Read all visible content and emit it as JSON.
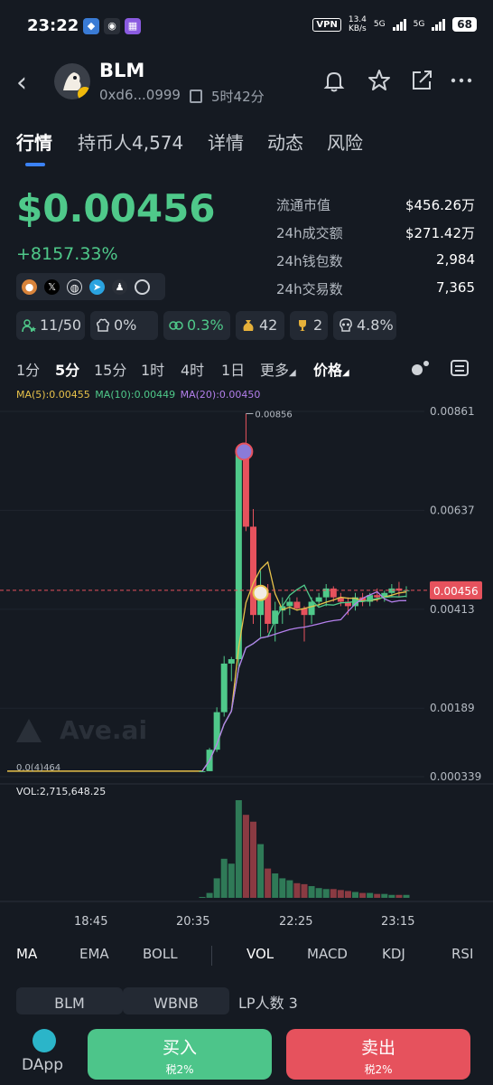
{
  "status": {
    "time": "23:22",
    "vpn": "VPN",
    "net_speed": "13.4",
    "net_unit": "KB/s",
    "sig1": "5G",
    "sig2": "5G",
    "battery": "68"
  },
  "header": {
    "name": "BLM",
    "address": "0xd6...0999",
    "age": "5时42分"
  },
  "tabs": [
    {
      "label": "行情"
    },
    {
      "label": "持币人4,574"
    },
    {
      "label": "详情"
    },
    {
      "label": "动态"
    },
    {
      "label": "风险"
    }
  ],
  "price": {
    "value": "$0.00456",
    "change": "+8157.33%"
  },
  "metrics": [
    {
      "label": "流通市值",
      "value": "$456.26万"
    },
    {
      "label": "24h成交额",
      "value": "$271.42万"
    },
    {
      "label": "24h钱包数",
      "value": "2,984"
    },
    {
      "label": "24h交易数",
      "value": "7,365"
    }
  ],
  "badges": [
    {
      "value": "11/50",
      "icon": "users-star-icon"
    },
    {
      "value": "0%",
      "icon": "chef-hat-icon"
    },
    {
      "value": "0.3%",
      "icon": "link-icon"
    },
    {
      "value": "42",
      "icon": "money-bag-icon"
    },
    {
      "value": "2",
      "icon": "trophy-icon"
    },
    {
      "value": "4.8%",
      "icon": "skull-icon"
    }
  ],
  "intervals": [
    {
      "label": "1分"
    },
    {
      "label": "5分"
    },
    {
      "label": "15分"
    },
    {
      "label": "1时"
    },
    {
      "label": "4时"
    },
    {
      "label": "1日"
    },
    {
      "label": "更多"
    },
    {
      "label": "价格"
    }
  ],
  "ma_legend": {
    "ma5": "MA(5):0.00455",
    "ma10": "MA(10):0.00449",
    "ma20": "MA(20):0.00450"
  },
  "colors": {
    "up": "#4fc98a",
    "down": "#e6525d",
    "ma5": "#e8c24a",
    "ma10": "#4fc98a",
    "ma20": "#b37feb",
    "accent": "#3b82f6"
  },
  "chart_data": {
    "type": "candlestick",
    "y_ticks": [
      "0.00861",
      "0.00637",
      "0.00413",
      "0.00189",
      "0.000339"
    ],
    "current_price": "0.00456",
    "high_label": "0.00856",
    "low_label": "0.0(4)464",
    "volume_label": "VOL:2,715,648.25",
    "watermark": "Ave.ai",
    "x_ticks": [
      "18:45",
      "20:35",
      "22:25",
      "23:15"
    ],
    "candles": [
      {
        "o": 0.000464,
        "h": 0.000464,
        "l": 0.000464,
        "c": 0.000464
      },
      {
        "o": 0.000464,
        "h": 0.00099,
        "l": 0.000464,
        "c": 0.00095
      },
      {
        "o": 0.00095,
        "h": 0.00191,
        "l": 0.0009,
        "c": 0.0018
      },
      {
        "o": 0.0018,
        "h": 0.00307,
        "l": 0.0017,
        "c": 0.0029
      },
      {
        "o": 0.0029,
        "h": 0.00305,
        "l": 0.0025,
        "c": 0.003
      },
      {
        "o": 0.003,
        "h": 0.00782,
        "l": 0.0028,
        "c": 0.0077
      },
      {
        "o": 0.0077,
        "h": 0.00856,
        "l": 0.0059,
        "c": 0.006
      },
      {
        "o": 0.006,
        "h": 0.0064,
        "l": 0.0038,
        "c": 0.004
      },
      {
        "o": 0.004,
        "h": 0.005,
        "l": 0.0035,
        "c": 0.0045
      },
      {
        "o": 0.0045,
        "h": 0.0047,
        "l": 0.0036,
        "c": 0.0038
      },
      {
        "o": 0.0038,
        "h": 0.0043,
        "l": 0.0034,
        "c": 0.0041
      },
      {
        "o": 0.0041,
        "h": 0.0044,
        "l": 0.0038,
        "c": 0.0042
      },
      {
        "o": 0.0042,
        "h": 0.0044,
        "l": 0.004,
        "c": 0.0043
      },
      {
        "o": 0.0043,
        "h": 0.0044,
        "l": 0.0041,
        "c": 0.00415
      },
      {
        "o": 0.00415,
        "h": 0.0042,
        "l": 0.0034,
        "c": 0.004
      },
      {
        "o": 0.004,
        "h": 0.0044,
        "l": 0.0038,
        "c": 0.0043
      },
      {
        "o": 0.0043,
        "h": 0.0045,
        "l": 0.0042,
        "c": 0.0044
      },
      {
        "o": 0.0044,
        "h": 0.0047,
        "l": 0.0042,
        "c": 0.0046
      },
      {
        "o": 0.0046,
        "h": 0.00465,
        "l": 0.0043,
        "c": 0.0044
      },
      {
        "o": 0.0044,
        "h": 0.0045,
        "l": 0.0042,
        "c": 0.0043
      },
      {
        "o": 0.0043,
        "h": 0.0044,
        "l": 0.004,
        "c": 0.0042
      },
      {
        "o": 0.0042,
        "h": 0.0045,
        "l": 0.0041,
        "c": 0.0044
      },
      {
        "o": 0.0044,
        "h": 0.0045,
        "l": 0.0042,
        "c": 0.0043
      },
      {
        "o": 0.0043,
        "h": 0.0045,
        "l": 0.0042,
        "c": 0.00445
      },
      {
        "o": 0.00445,
        "h": 0.0046,
        "l": 0.0043,
        "c": 0.0044
      },
      {
        "o": 0.0044,
        "h": 0.00455,
        "l": 0.0043,
        "c": 0.0045
      },
      {
        "o": 0.0045,
        "h": 0.0047,
        "l": 0.0044,
        "c": 0.0046
      },
      {
        "o": 0.0046,
        "h": 0.00475,
        "l": 0.0044,
        "c": 0.00455
      },
      {
        "o": 0.00455,
        "h": 0.00465,
        "l": 0.0044,
        "c": 0.00456
      }
    ],
    "volumes": [
      0,
      0.05,
      0.2,
      0.4,
      0.35,
      1.0,
      0.85,
      0.78,
      0.55,
      0.3,
      0.25,
      0.2,
      0.18,
      0.15,
      0.14,
      0.12,
      0.1,
      0.09,
      0.09,
      0.08,
      0.07,
      0.06,
      0.05,
      0.05,
      0.04,
      0.04,
      0.03,
      0.03,
      0.03
    ]
  },
  "indicator_tabs": [
    "MA",
    "EMA",
    "BOLL",
    "VOL",
    "MACD",
    "KDJ",
    "RSI"
  ],
  "pair": {
    "base": "BLM",
    "quote": "WBNB",
    "lp_label": "LP人数",
    "lp_count": "3"
  },
  "bottom": {
    "dapp": "DApp",
    "buy": "买入",
    "buy_tax": "税2%",
    "sell": "卖出",
    "sell_tax": "税2%"
  }
}
